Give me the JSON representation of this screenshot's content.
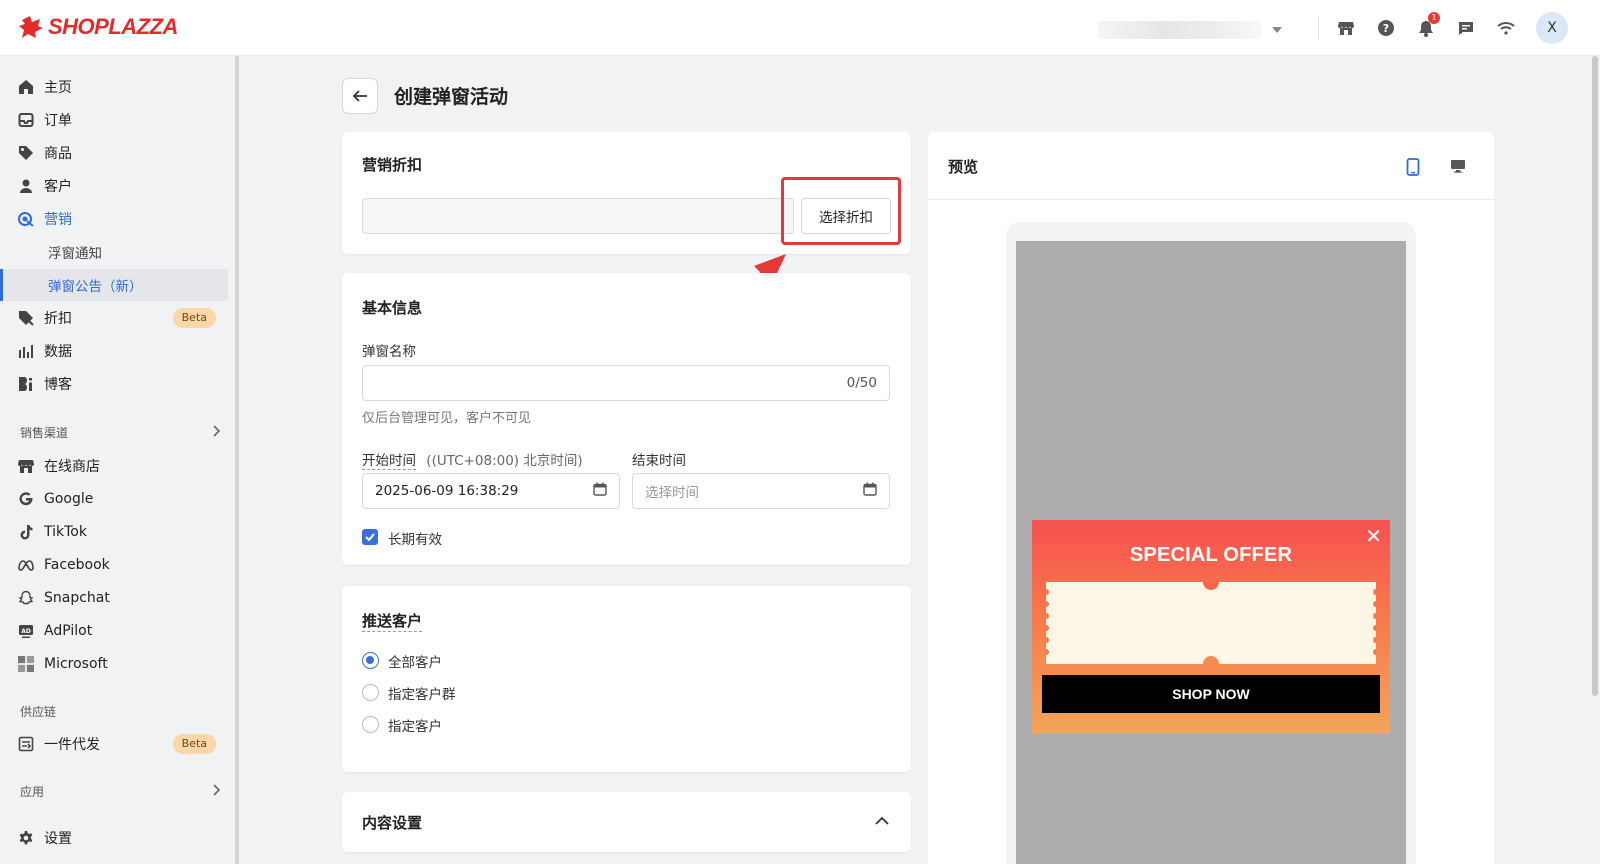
{
  "brand": {
    "logo_text": "SHOPLAZZA",
    "accent": "#e32b2b"
  },
  "topbar": {
    "avatar_letter": "X",
    "notification_count": "1"
  },
  "sidebar": {
    "items": [
      {
        "label": "主页",
        "icon": "home-icon"
      },
      {
        "label": "订单",
        "icon": "inbox-icon"
      },
      {
        "label": "商品",
        "icon": "tag-icon"
      },
      {
        "label": "客户",
        "icon": "user-icon"
      },
      {
        "label": "营销",
        "icon": "target-icon"
      }
    ],
    "marketing_sub": [
      "浮窗通知",
      "弹窗公告（新）"
    ],
    "items2": [
      {
        "label": "折扣",
        "icon": "discount-icon",
        "badge": "Beta"
      },
      {
        "label": "数据",
        "icon": "bar-chart-icon"
      },
      {
        "label": "博客",
        "icon": "blog-icon"
      }
    ],
    "sales_channels_label": "销售渠道",
    "channels": [
      "在线商店",
      "Google",
      "TikTok",
      "Facebook",
      "Snapchat",
      "AdPilot",
      "Microsoft"
    ],
    "supply_label": "供应链",
    "supply_item": {
      "label": "一件代发",
      "badge": "Beta"
    },
    "apps_label": "应用",
    "settings_label": "设置"
  },
  "page": {
    "title": "创建弹窗活动"
  },
  "discount_card": {
    "title": "营销折扣",
    "select_button": "选择折扣"
  },
  "basic_info": {
    "title": "基本信息",
    "name_label": "弹窗名称",
    "name_counter": "0/50",
    "name_help": "仅后台管理可见，客户不可见",
    "start_label": "开始时间",
    "timezone": "((UTC+08:00) 北京时间)",
    "end_label": "结束时间",
    "start_value": "2025-06-09 16:38:29",
    "end_placeholder": "选择时间",
    "long_term_label": "长期有效"
  },
  "push_customers": {
    "title": "推送客户",
    "options": [
      "全部客户",
      "指定客户群",
      "指定客户"
    ]
  },
  "content_settings": {
    "title": "内容设置"
  },
  "preview": {
    "title": "预览",
    "popup_title": "SPECIAL OFFER",
    "button_text": "SHOP NOW",
    "close_glyph": "✕"
  }
}
